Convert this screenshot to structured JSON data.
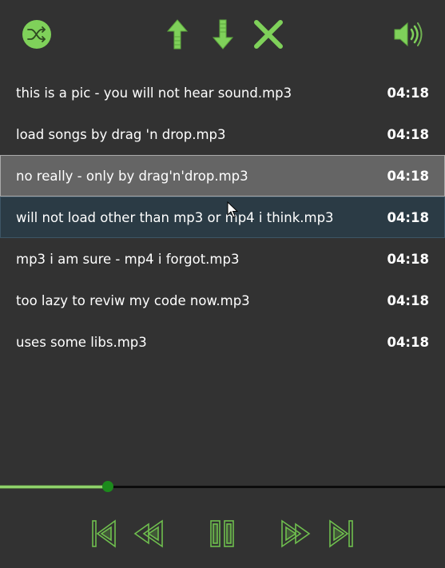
{
  "colors": {
    "background": "#323232",
    "accent_green": "#7fd15a",
    "selected_row": "#656565",
    "hover_row": "#2b3b45",
    "knob": "#1c8a1c",
    "text": "#ffffff"
  },
  "toolbar": {
    "shuffle_icon": "shuffle-icon",
    "move_up_icon": "arrow-up-icon",
    "move_down_icon": "arrow-down-icon",
    "remove_icon": "close-icon",
    "volume_icon": "speaker-icon"
  },
  "playlist": {
    "selected_index": 2,
    "hover_index": 3,
    "tracks": [
      {
        "title": "this is a pic - you will not hear sound.mp3",
        "duration": "04:18"
      },
      {
        "title": "load songs by drag 'n drop.mp3",
        "duration": "04:18"
      },
      {
        "title": "no really - only by drag'n'drop.mp3",
        "duration": "04:18"
      },
      {
        "title": "will not load other than mp3 or mp4 i think.mp3",
        "duration": "04:18"
      },
      {
        "title": "mp3 i am sure - mp4 i forgot.mp3",
        "duration": "04:18"
      },
      {
        "title": "too lazy to reviw my code now.mp3",
        "duration": "04:18"
      },
      {
        "title": "uses some libs.mp3",
        "duration": "04:18"
      }
    ]
  },
  "progress": {
    "fraction": 0.243
  },
  "transport": {
    "previous_icon": "skip-previous-icon",
    "rewind_icon": "rewind-icon",
    "pause_icon": "pause-icon",
    "fast_forward_icon": "fast-forward-icon",
    "next_icon": "skip-next-icon"
  }
}
